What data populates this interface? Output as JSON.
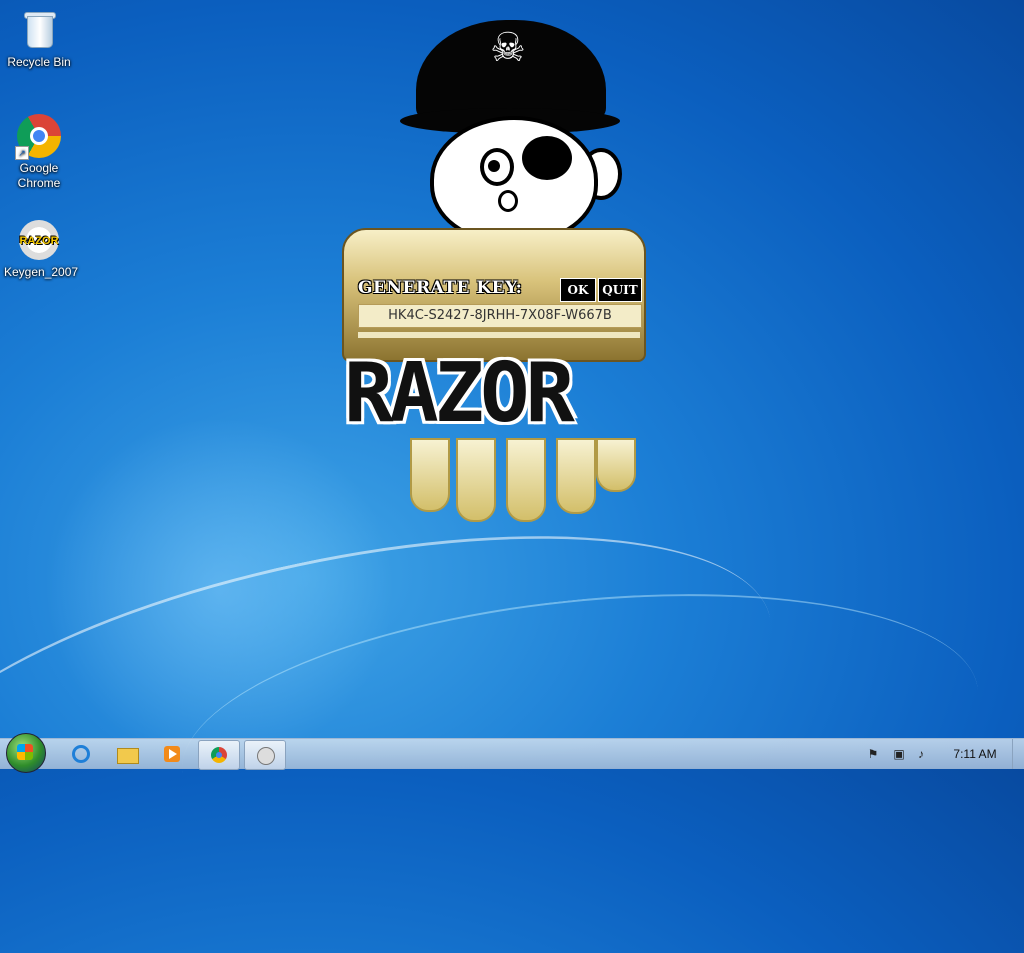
{
  "desktop": {
    "icons": [
      {
        "label": "Recycle Bin",
        "icon": "recycle-bin-icon"
      },
      {
        "label": "Google Chrome",
        "icon": "chrome-icon"
      },
      {
        "label": "Keygen_2007",
        "icon": "razor-keygen-icon"
      }
    ]
  },
  "keygen": {
    "title": "GENERATE KEY:",
    "ok_label": "OK",
    "quit_label": "QUIT",
    "key_value": "HK4C-S2427-8JRHH-7X08F-W667B",
    "logo_text": "RAZOR",
    "icon_text": "RAZOR"
  },
  "taskbar": {
    "items": [
      {
        "icon": "internet-explorer-icon"
      },
      {
        "icon": "folder-icon"
      },
      {
        "icon": "media-player-icon"
      },
      {
        "icon": "chrome-icon"
      },
      {
        "icon": "keygen-icon"
      }
    ],
    "tray": [
      "flag-icon",
      "network-icon",
      "volume-icon"
    ],
    "clock": "7:11 AM"
  },
  "colors": {
    "accent": "#0b5fbf",
    "panel": "#d8c27a"
  }
}
